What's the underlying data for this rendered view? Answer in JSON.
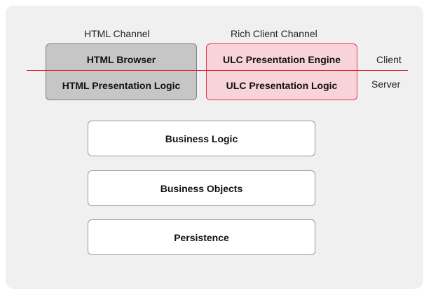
{
  "channels": {
    "html_title": "HTML Channel",
    "rich_title": "Rich Client Channel"
  },
  "tiers": {
    "client": "Client",
    "server": "Server"
  },
  "html_channel": {
    "top_box": "HTML Browser",
    "bottom_box": "HTML Presentation Logic"
  },
  "rich_channel": {
    "top_box": "ULC Presentation Engine",
    "bottom_box": "ULC Presentation Logic"
  },
  "layers": [
    {
      "label": "Business Logic"
    },
    {
      "label": "Business Objects"
    },
    {
      "label": "Persistence"
    }
  ],
  "colors": {
    "panel_background": "#f0f0f0",
    "html_box_fill": "#c6c6c6",
    "rich_box_fill": "#f8d4d8",
    "rich_box_border": "#e3384b",
    "tier_divider": "#d61f34",
    "layer_box_fill": "#ffffff"
  }
}
